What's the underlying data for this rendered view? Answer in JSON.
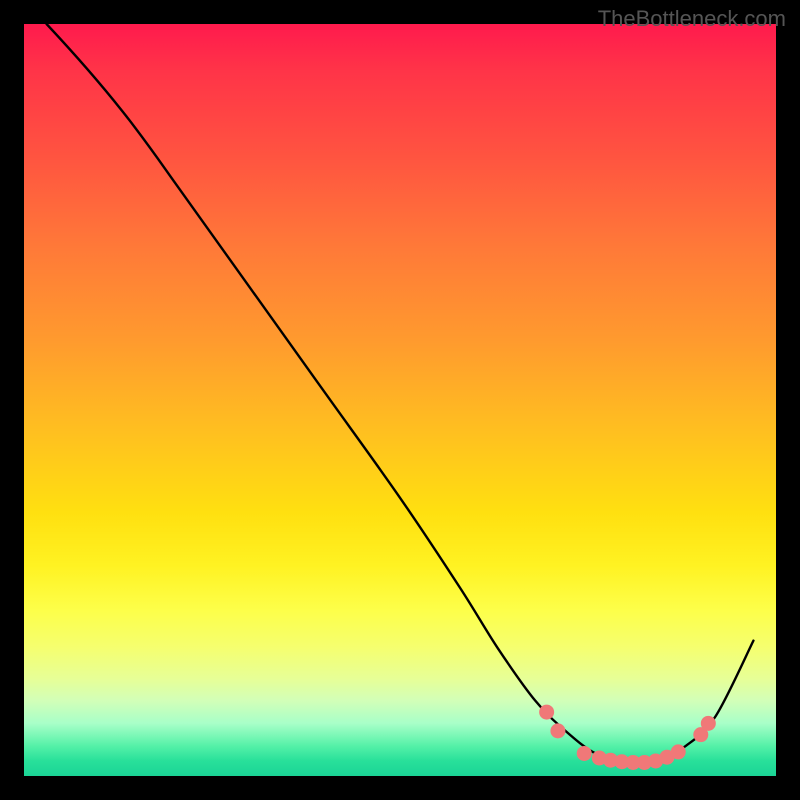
{
  "watermark": "TheBottleneck.com",
  "chart_data": {
    "type": "line",
    "title": "",
    "xlabel": "",
    "ylabel": "",
    "xlim": [
      0,
      100
    ],
    "ylim": [
      0,
      100
    ],
    "grid": false,
    "series": [
      {
        "name": "curve",
        "x": [
          3,
          10,
          20,
          30,
          40,
          50,
          58,
          63,
          68,
          72,
          76,
          80,
          84,
          88,
          92,
          97
        ],
        "y": [
          100,
          93,
          79,
          65,
          51,
          37,
          25,
          17,
          10,
          6,
          3,
          2,
          2,
          4,
          8,
          18
        ],
        "color": "#000000"
      }
    ],
    "markers": [
      {
        "x": 69.5,
        "y": 8.5
      },
      {
        "x": 71.0,
        "y": 6.0
      },
      {
        "x": 74.5,
        "y": 3.0
      },
      {
        "x": 76.5,
        "y": 2.4
      },
      {
        "x": 78.0,
        "y": 2.1
      },
      {
        "x": 79.5,
        "y": 1.9
      },
      {
        "x": 81.0,
        "y": 1.8
      },
      {
        "x": 82.5,
        "y": 1.8
      },
      {
        "x": 84.0,
        "y": 2.0
      },
      {
        "x": 85.5,
        "y": 2.5
      },
      {
        "x": 87.0,
        "y": 3.2
      },
      {
        "x": 90.0,
        "y": 5.5
      },
      {
        "x": 91.0,
        "y": 7.0
      }
    ],
    "marker_color": "#f07878"
  }
}
